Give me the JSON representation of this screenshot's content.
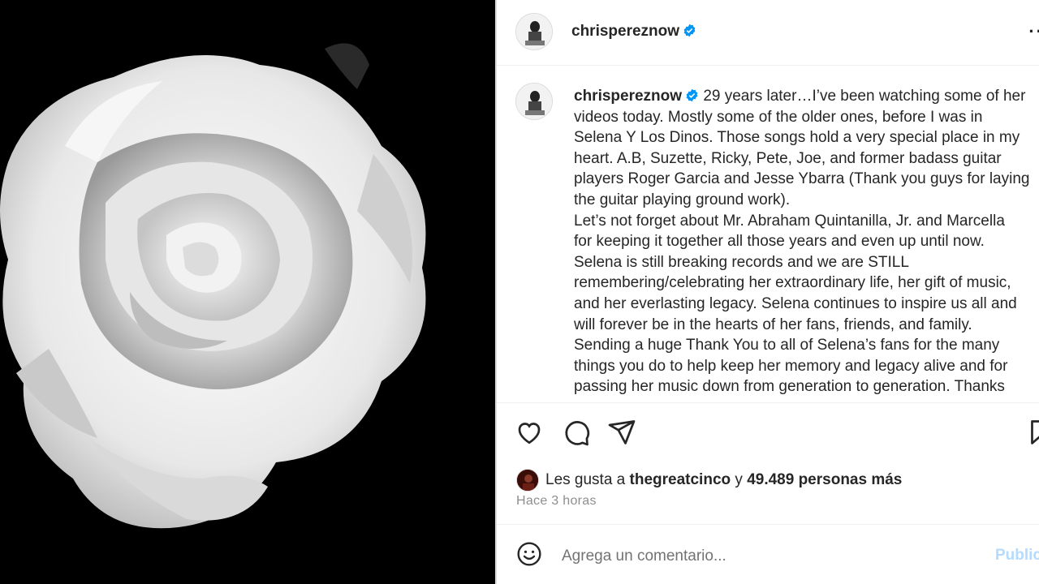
{
  "post": {
    "username": "chrispereznow",
    "verified_icon": "verified-badge-icon",
    "more_icon": "more-options-icon",
    "more_label": "··",
    "caption_user": "chrispereznow",
    "caption_lines": [
      "29 years later…I’ve been watching some of her",
      "videos today. Mostly some of the older ones, before I was in",
      "Selena Y Los Dinos. Those songs hold a very special place in my",
      "heart. A.B, Suzette, Ricky, Pete, Joe, and former badass guitar",
      "players Roger Garcia and Jesse Ybarra (Thank you guys for laying",
      "the guitar playing ground work).",
      "Let’s not forget about Mr. Abraham Quintanilla, Jr. and Marcella",
      "for keeping it together all those years and even up until now.",
      "Selena is still breaking records and we are STILL",
      "remembering/celebrating her extraordinary life, her gift of music,",
      "and her everlasting legacy. Selena continues to inspire us all and",
      "will forever be in the hearts of her fans, friends, and family.",
      "Sending a huge Thank You to all of Selena’s fans for the many",
      "things you do to help keep her memory and legacy alive and for",
      "passing her music down from generation to generation. Thanks"
    ]
  },
  "actions": {
    "like_icon": "heart-icon",
    "comment_icon": "comment-icon",
    "share_icon": "share-icon",
    "save_icon": "bookmark-icon"
  },
  "likes": {
    "prefix": "Les gusta a",
    "liker": "thegreatcinco",
    "connector": "y",
    "count_text": "49.489 personas más"
  },
  "time_ago": "Hace 3 horas",
  "comment": {
    "emoji_icon": "emoji-icon",
    "placeholder": "Agrega un comentario...",
    "post_label": "Publicar"
  },
  "colors": {
    "verified": "#0095f6",
    "post_button": "#b3dbff",
    "secondary_text": "#8e8e8e"
  }
}
